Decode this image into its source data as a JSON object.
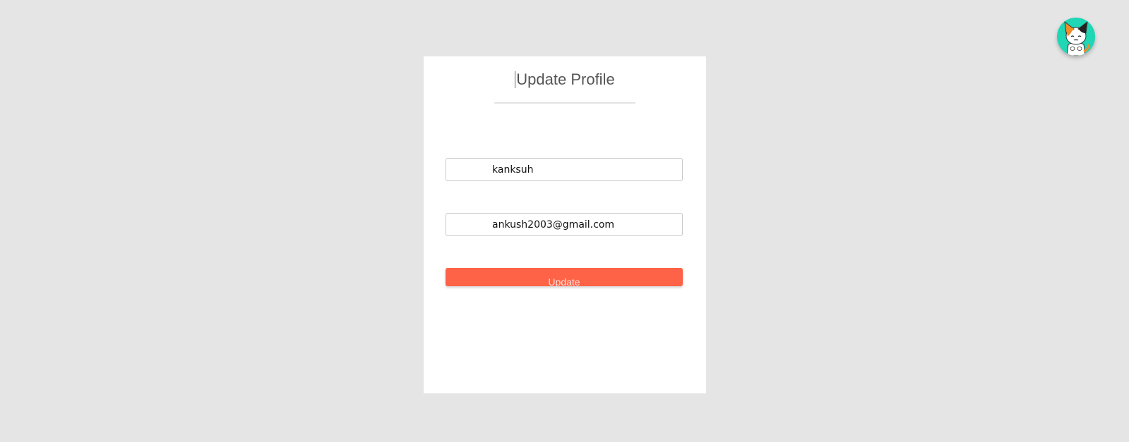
{
  "profile_form": {
    "title": "Update Profile",
    "name_value": "kanksuh",
    "email_value": "ankush2003@gmail.com",
    "submit_label": "Update"
  },
  "header": {
    "avatar_icon": "cat-avatar-icon"
  },
  "colors": {
    "page_background": "#e5e5e5",
    "card_background": "#ffffff",
    "button_accent": "#ff6347",
    "avatar_background": "#1fd6b5"
  }
}
